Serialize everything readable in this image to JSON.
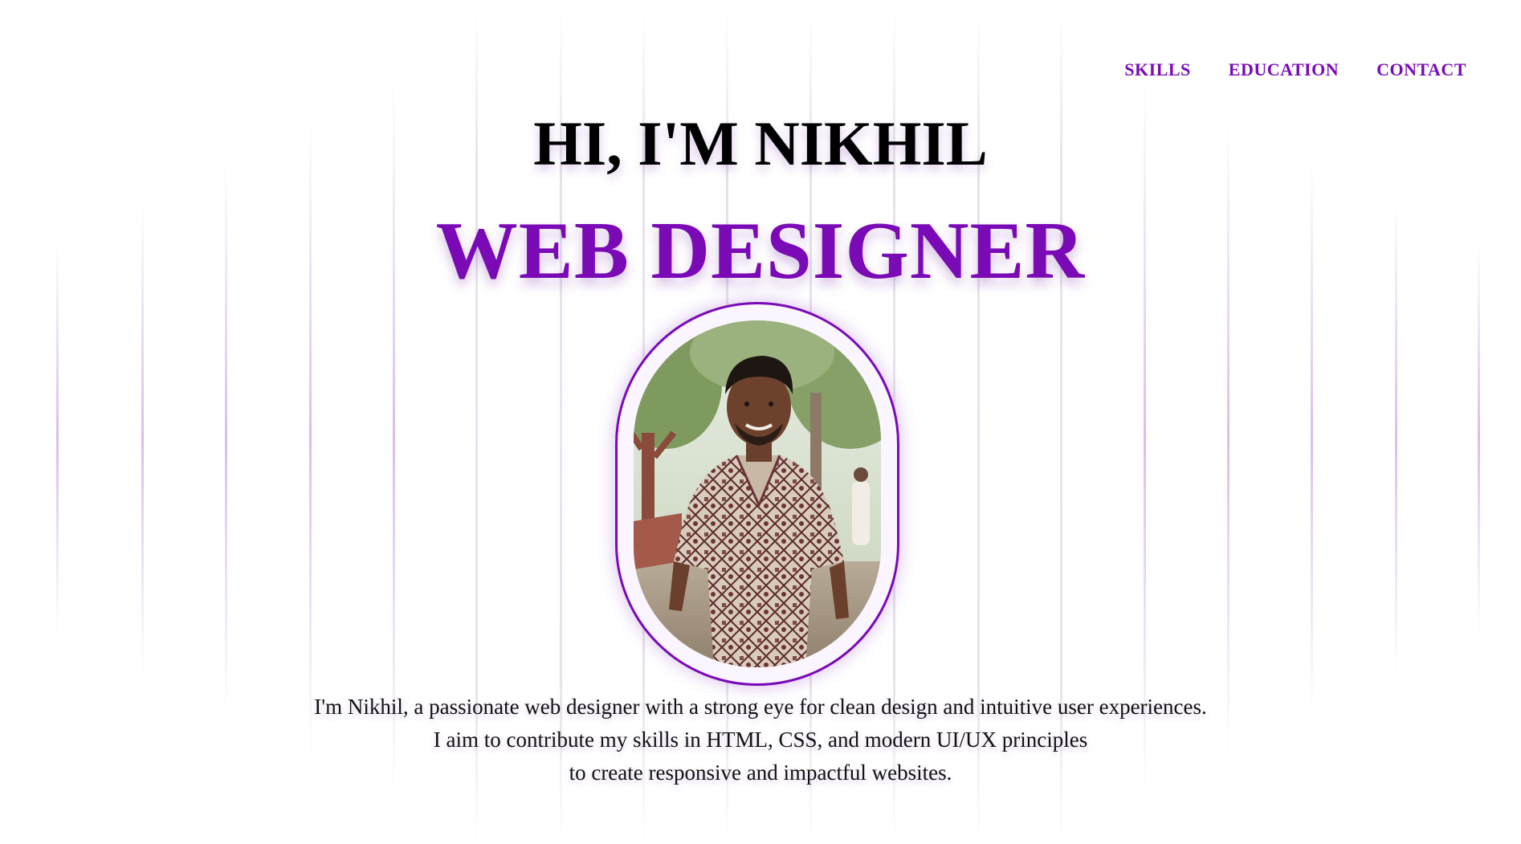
{
  "nav": {
    "items": [
      {
        "label": "SKILLS"
      },
      {
        "label": "EDUCATION"
      },
      {
        "label": "CONTACT"
      }
    ]
  },
  "hero": {
    "greeting": "HI, I'M NIKHIL",
    "role": "WEB DESIGNER",
    "portrait_icon": "profile-photo"
  },
  "bio": {
    "lines": [
      "I'm Nikhil, a passionate web designer with a strong eye for clean design and intuitive user experiences.",
      "I aim to contribute my skills in HTML, CSS, and modern UI/UX principles",
      "to create responsive and impactful websites."
    ]
  },
  "colors": {
    "accent": "#7a0ab5",
    "text": "#000000",
    "background": "#ffffff"
  }
}
